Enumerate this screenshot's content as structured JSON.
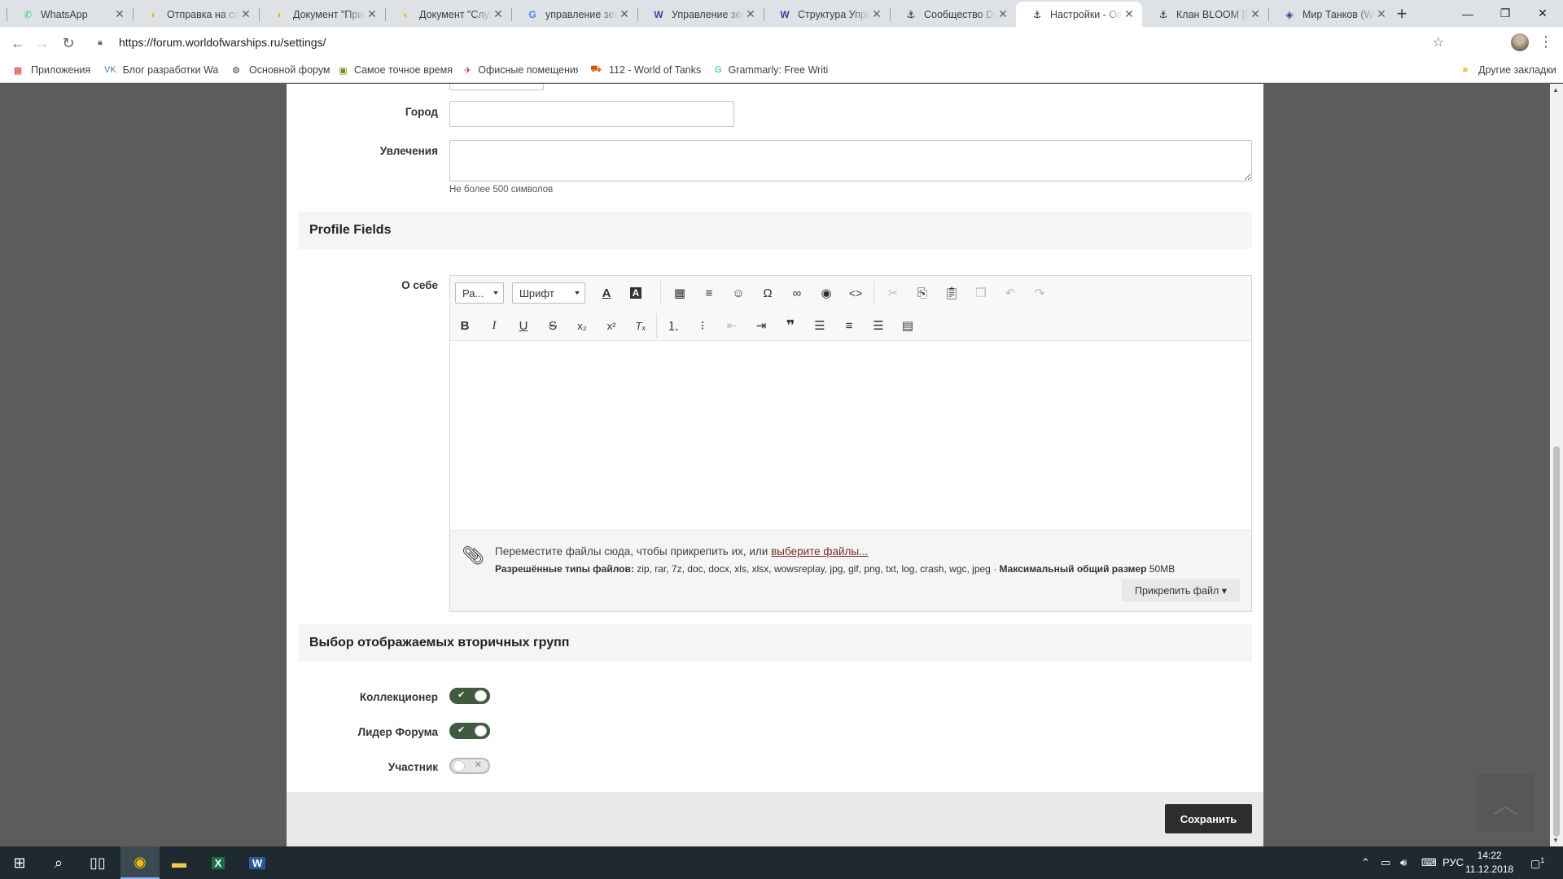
{
  "browser": {
    "tabs": [
      {
        "label": "WhatsApp",
        "icon": "whatsapp-icon",
        "glyph": "✆",
        "color": "#25d366"
      },
      {
        "label": "Отправка на согласование",
        "icon": "docs-icon",
        "glyph": "◐",
        "color": "#f4b400"
      },
      {
        "label": "Документ \"Приказ\"",
        "icon": "docs-icon",
        "glyph": "◐",
        "color": "#f4b400"
      },
      {
        "label": "Документ \"Служебная записка\"",
        "icon": "docs-icon",
        "glyph": "◐",
        "color": "#f4b400"
      },
      {
        "label": "управление земельными",
        "icon": "google-icon",
        "glyph": "G",
        "color": "#4285f4"
      },
      {
        "label": "Управление земельных",
        "icon": "wiki-icon",
        "glyph": "W",
        "color": "#4a3aa6"
      },
      {
        "label": "Структура Управления",
        "icon": "wiki-icon",
        "glyph": "W",
        "color": "#4a3aa6"
      },
      {
        "label": "Сообщество DOWS",
        "icon": "wows-icon",
        "glyph": "⚓",
        "color": "#1a1a1a"
      },
      {
        "label": "Настройки - Официальный",
        "icon": "wows-icon",
        "glyph": "⚓",
        "color": "#1a1a1a",
        "active": true
      },
      {
        "label": "Клан BLOOM [BLOOM]",
        "icon": "wows-icon",
        "glyph": "⚓",
        "color": "#1a1a1a"
      },
      {
        "label": "Мир Танков (World",
        "icon": "wot-icon",
        "glyph": "◈",
        "color": "#2d3e8a"
      }
    ],
    "url": "https://forum.worldofwarships.ru/settings/",
    "bookmarks": [
      {
        "label": "Приложения",
        "icon": "apps-grid-icon",
        "glyph": "▦",
        "color": "#d93025"
      },
      {
        "label": "Блог разработки Wargaming",
        "icon": "vk-icon",
        "glyph": "VK",
        "color": "#4a76a8"
      },
      {
        "label": "Основной форум",
        "icon": "forum-icon",
        "glyph": "⚙",
        "color": "#333"
      },
      {
        "label": "Самое точное время",
        "icon": "time-icon",
        "glyph": "▣",
        "color": "#6b8e23"
      },
      {
        "label": "Офисные помещения",
        "icon": "office-icon",
        "glyph": "✈",
        "color": "#c0392b"
      },
      {
        "label": "112 - World of Tanks",
        "icon": "tank-icon",
        "glyph": "⛟",
        "color": "#d35400"
      },
      {
        "label": "Grammarly: Free Writing",
        "icon": "grammarly-icon",
        "glyph": "G",
        "color": "#15c39a"
      }
    ],
    "other_bookmarks": "Другие закладки"
  },
  "form": {
    "city_label": "Город",
    "city_value": "",
    "hobbies_label": "Увлечения",
    "hobbies_value": "",
    "hobbies_hint": "Не более 500 символов",
    "profile_fields_title": "Profile Fields",
    "about_label": "О себе",
    "editor": {
      "format_select": "Ра...",
      "font_select": "Шрифт",
      "content": "",
      "drop_text": "Переместите файлы сюда, чтобы прикрепить их, или",
      "choose_files": "выберите файлы...",
      "allowed_label": "Разрешённые типы файлов:",
      "allowed_types": "zip, rar, 7z, doc, docx, xls, xlsx, wowsreplay, jpg, gif, png, txt, log, crash, wgc, jpeg",
      "sep": "·",
      "max_label": "Максимальный общий размер",
      "max_value": "50MB",
      "attach_button": "Прикрепить файл ▾"
    },
    "groups_title": "Выбор отображаемых вторичных групп",
    "groups": [
      {
        "label": "Коллекционер",
        "enabled": true
      },
      {
        "label": "Лидер Форума",
        "enabled": true
      },
      {
        "label": "Участник",
        "enabled": false
      }
    ],
    "save_button": "Сохранить"
  },
  "taskbar": {
    "lang": "РУС",
    "time": "14:22",
    "date": "11.12.2018",
    "notifications": "1"
  }
}
